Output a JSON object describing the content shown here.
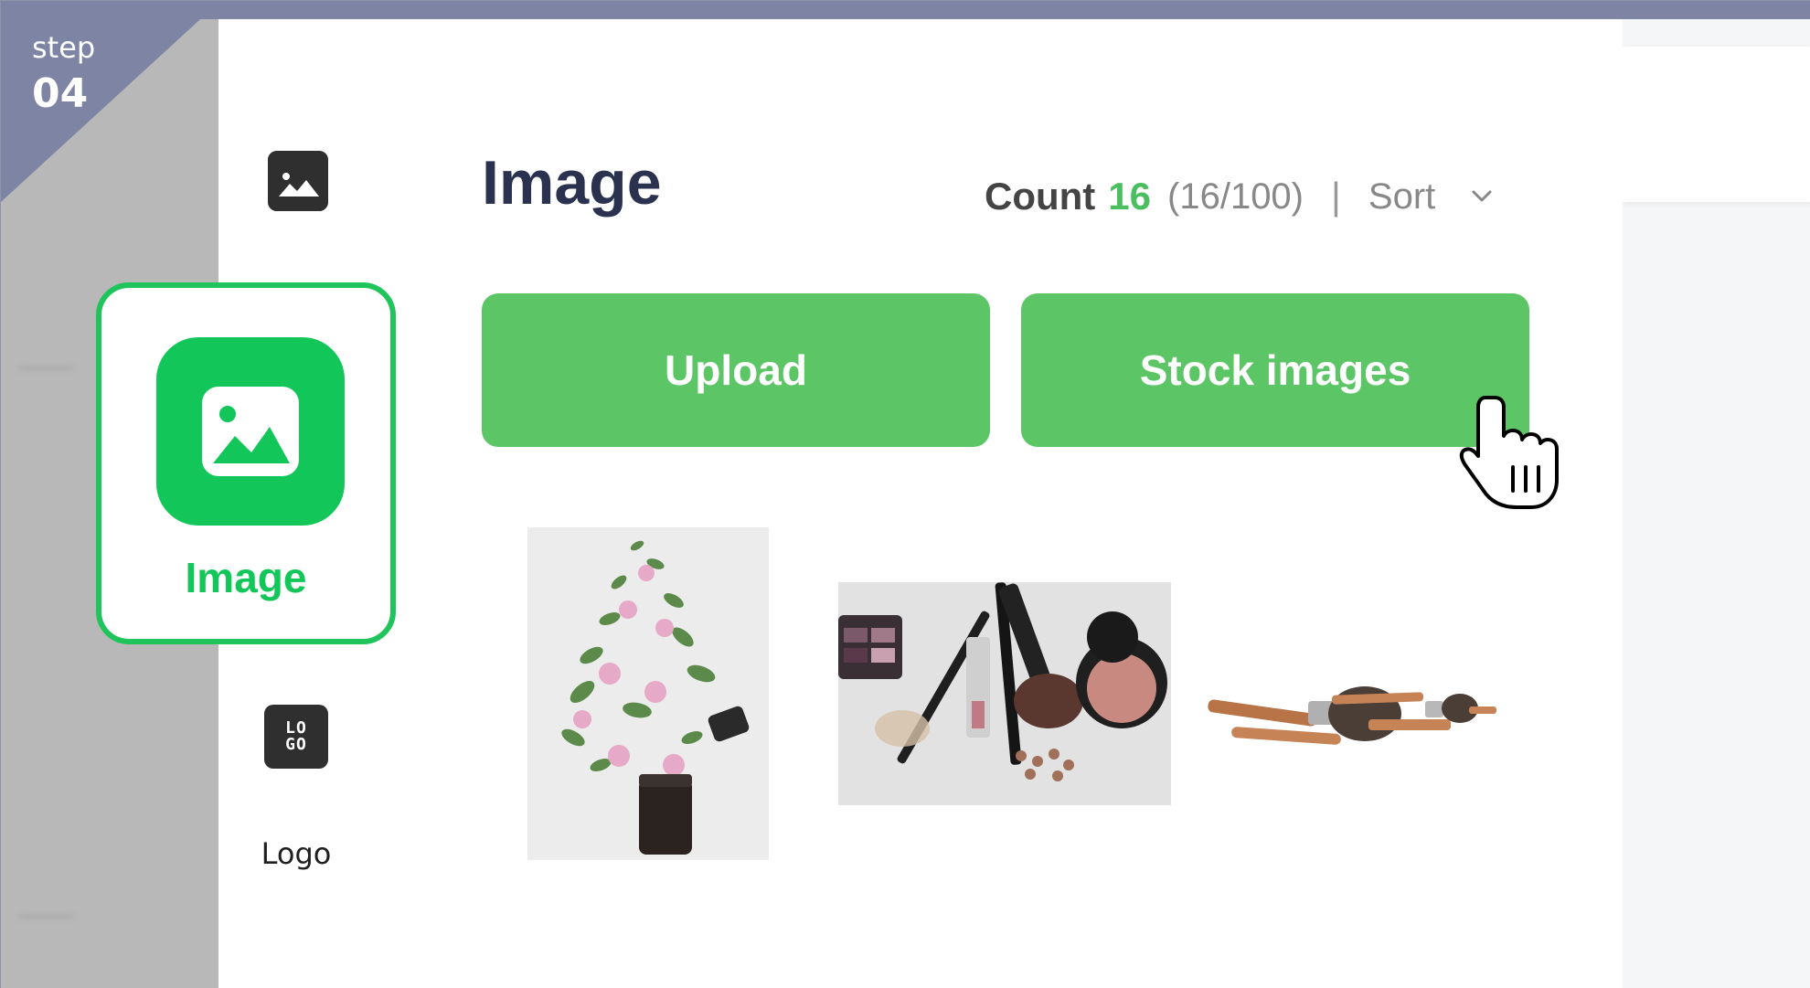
{
  "step": {
    "label": "step",
    "number": "04"
  },
  "sidebar": {
    "image_icon": "image-icon",
    "highlight_label": "Image",
    "logo_icon_text_line1": "LO",
    "logo_icon_text_line2": "GO",
    "logo_label": "Logo"
  },
  "main": {
    "title": "Image",
    "count_label": "Count",
    "count_value": "16",
    "count_ratio": "(16/100)",
    "separator": "|",
    "sort_label": "Sort",
    "upload_button": "Upload",
    "stock_button": "Stock images"
  },
  "colors": {
    "accent_green": "#13c65a",
    "button_green": "#5cc565",
    "count_green": "#4bbf5f",
    "title_navy": "#2b3250",
    "step_badge": "#7e84a3"
  },
  "images": [
    {
      "name": "flowers-and-jar-thumbnail"
    },
    {
      "name": "makeup-palette-thumbnail"
    },
    {
      "name": "makeup-brushes-thumbnail"
    }
  ]
}
